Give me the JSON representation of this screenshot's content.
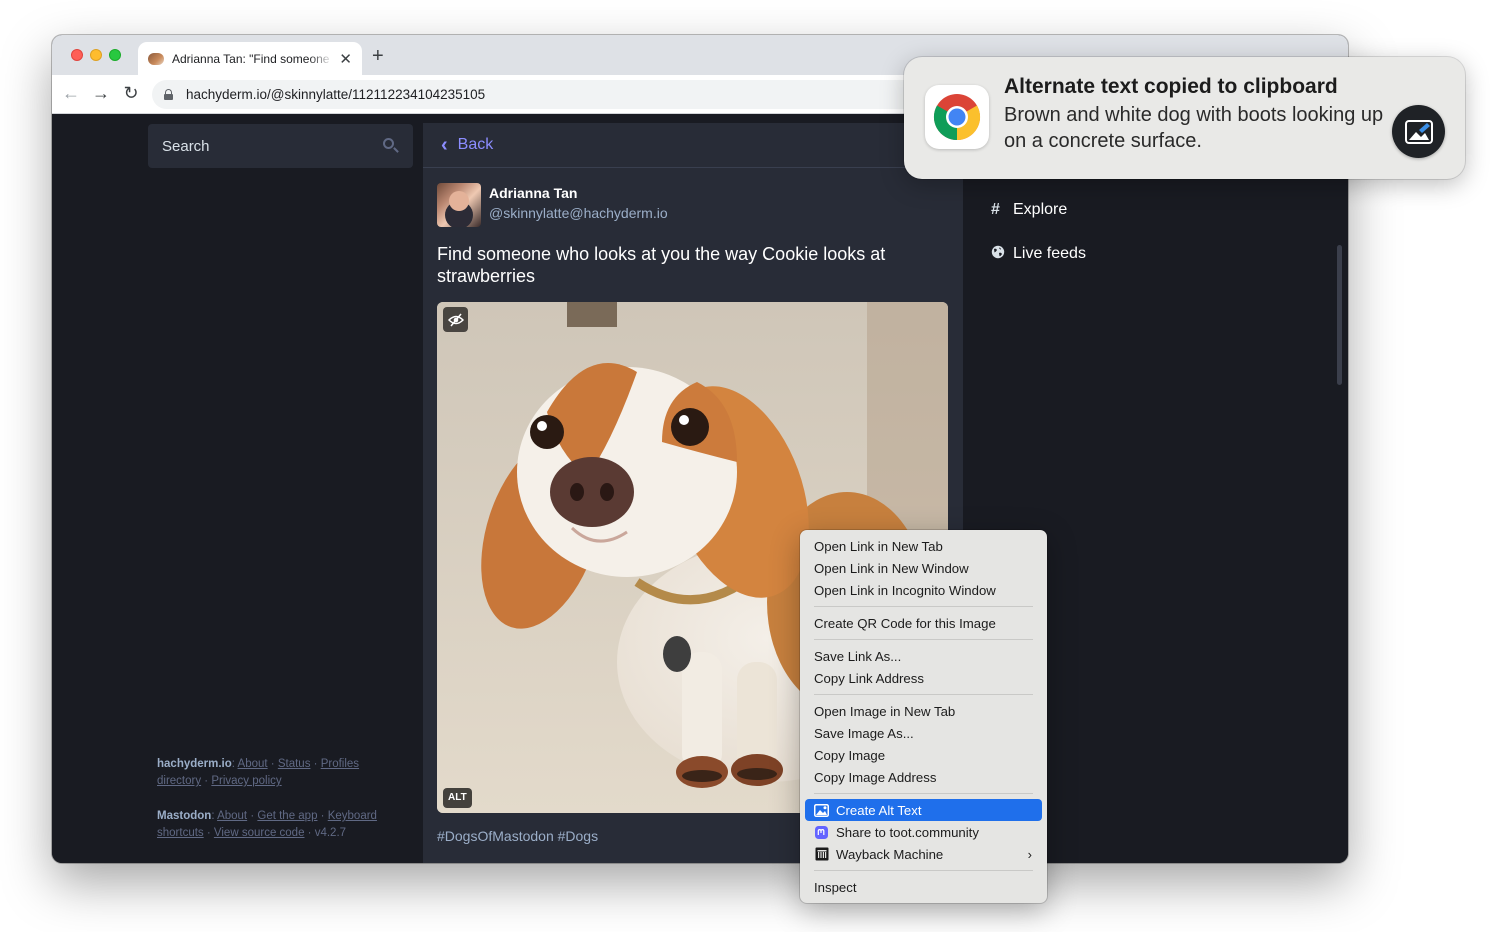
{
  "browser": {
    "tab_title": "Adrianna Tan: \"Find someone who looks at you the way Cookie looks at strawberries\"",
    "url": "hachyderm.io/@skinnylatte/112112234104235105",
    "new_tab_glyph": "+",
    "close_glyph": "✕",
    "back_glyph": "←",
    "forward_glyph": "→",
    "reload_glyph": "↻"
  },
  "left": {
    "search_placeholder": "Search",
    "footer": {
      "site": "hachyderm.io",
      "site_links": [
        "About",
        "Status",
        "Profiles directory",
        "Privacy policy"
      ],
      "mastodon": "Mastodon",
      "mastodon_links": [
        "About",
        "Get the app",
        "Keyboard shortcuts",
        "View source code"
      ],
      "version": "v4.2.7"
    }
  },
  "column": {
    "back_label": "Back",
    "status": {
      "author_name": "Adrianna Tan",
      "author_handle": "@skinnylatte@hachyderm.io",
      "text": "Find someone who looks at you the way Cookie looks at strawberries",
      "alt_badge": "ALT",
      "hashtags": "#DogsOfMastodon #Dogs"
    }
  },
  "right_nav": {
    "items": [
      {
        "glyph": "#",
        "label": "Explore",
        "icon": "hashtag-icon"
      },
      {
        "glyph": "●",
        "label": "Live feeds",
        "icon": "globe-icon"
      }
    ]
  },
  "context_menu": {
    "groups": [
      [
        "Open Link in New Tab",
        "Open Link in New Window",
        "Open Link in Incognito Window"
      ],
      [
        "Create QR Code for this Image"
      ],
      [
        "Save Link As...",
        "Copy Link Address"
      ],
      [
        "Open Image in New Tab",
        "Save Image As...",
        "Copy Image",
        "Copy Image Address"
      ],
      [
        "Create Alt Text",
        "Share to toot.community",
        "Wayback Machine"
      ],
      [
        "Inspect"
      ]
    ],
    "active_item": "Create Alt Text",
    "submenu_arrow": "›",
    "colors": {
      "highlight": "#1f6feb"
    }
  },
  "toast": {
    "title": "Alternate text copied to clipboard",
    "body": "Brown and white dog with boots looking up on a concrete surface.",
    "app_icon": "chrome-logo",
    "action_icon": "alt-text-image-icon"
  },
  "colors": {
    "page_bg": "#191b22",
    "column_bg": "#282c37",
    "accent": "#8c8dff",
    "muted": "#9baec8"
  }
}
